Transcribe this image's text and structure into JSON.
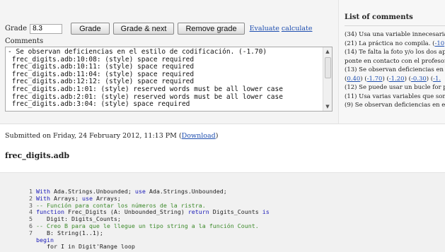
{
  "grading": {
    "grade_label": "Grade",
    "grade_value": "8.3",
    "buttons": {
      "grade": "Grade",
      "grade_next": "Grade & next",
      "remove": "Remove grade"
    },
    "links": {
      "evaluate": "Evaluate",
      "calculate": "calculate"
    },
    "comments_label": "Comments",
    "comments_text": "- Se observan deficiencias en el estilo de codificación. (-1.70)\n frec_digits.adb:10:08: (style) space required\n frec_digits.adb:10:11: (style) space required\n frec_digits.adb:11:04: (style) space required\n frec_digits.adb:12:12: (style) space required\n frec_digits.adb:1:01: (style) reserved words must be all lower case\n frec_digits.adb:2:01: (style) reserved words must be all lower case\n frec_digits.adb:3:04: (style) space required"
  },
  "comments_panel": {
    "title": "List of comments",
    "items": [
      {
        "text": "(34) Usa una variable innecesaria",
        "links": []
      },
      {
        "text": "(21) La práctica no compila. (",
        "links": [
          "-10"
        ]
      },
      {
        "text": "(14) Te falta la foto y/o los dos ap",
        "links": []
      },
      {
        "text": "ponte en contacto con el profesor",
        "links": []
      },
      {
        "text": "(13) Se observan deficiencias en e",
        "links": []
      },
      {
        "text": "",
        "links": [
          "0.40",
          "-1.70",
          "-1.20",
          "-0.30",
          "-1."
        ]
      },
      {
        "text": "(12) Se puede usar un bucle for pa",
        "links": []
      },
      {
        "text": "(11) Usa varias variables que son",
        "links": []
      },
      {
        "text": "(9) Se observan deficiencias en el",
        "links": []
      }
    ]
  },
  "submission": {
    "submitted_text": "Submitted on Friday, 24 February 2012, 11:13 PM (",
    "download_label": "Download",
    "close_paren": ")",
    "filename": "frec_digits.adb"
  },
  "code": [
    {
      "n": "1",
      "parts": [
        [
          "kw",
          "With"
        ],
        [
          "",
          "Ada.Strings.Unbounded; "
        ],
        [
          "kw",
          "use"
        ],
        [
          "",
          "Ada.Strings.Unbounded;"
        ]
      ]
    },
    {
      "n": "2",
      "parts": [
        [
          "kw",
          "With"
        ],
        [
          "",
          "Arrays; "
        ],
        [
          "kw",
          "use"
        ],
        [
          "",
          "Arrays;"
        ]
      ]
    },
    {
      "n": "3",
      "parts": [
        [
          "cm",
          "-- Función para contar los números de la ristra."
        ]
      ]
    },
    {
      "n": "4",
      "parts": [
        [
          "kw",
          "function"
        ],
        [
          "",
          "Frec_Digits (A: Unbounded_String) "
        ],
        [
          "kw",
          "return"
        ],
        [
          "",
          "Digits_Counts "
        ],
        [
          "kw",
          "is"
        ]
      ]
    },
    {
      "n": "5",
      "parts": [
        [
          "",
          "   Digit: Digits_Counts;"
        ]
      ]
    },
    {
      "n": "6",
      "parts": [
        [
          "cm",
          "-- Creo B para que le llegue un tipo string a la función Count."
        ]
      ]
    },
    {
      "n": "7",
      "parts": [
        [
          "",
          "   B: String(1..1);"
        ]
      ]
    },
    {
      "n": "",
      "parts": [
        [
          "kw",
          "begin"
        ]
      ]
    },
    {
      "n": "",
      "parts": [
        [
          "",
          "   for I in Digit'Range loop"
        ]
      ]
    }
  ]
}
